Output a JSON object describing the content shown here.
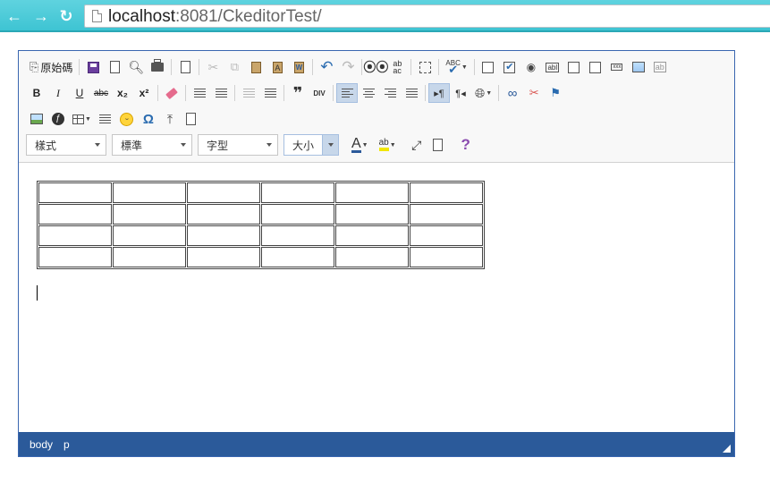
{
  "browser": {
    "url_host": "localhost",
    "url_rest": ":8081/CkeditorTest/"
  },
  "toolbar": {
    "source_label": "原始碼",
    "combos": {
      "styles": "樣式",
      "format": "標準",
      "font": "字型",
      "size": "大小"
    },
    "text": {
      "bold": "B",
      "italic": "I",
      "underline": "U",
      "strike": "abc",
      "subscript": "x₂",
      "superscript": "x²",
      "quote": "❞",
      "div": "DIV",
      "spell": "ABC",
      "omega": "Ω",
      "help": "?"
    }
  },
  "table": {
    "rows": 4,
    "cols": 6
  },
  "statusbar": {
    "path": [
      "body",
      "p"
    ]
  }
}
